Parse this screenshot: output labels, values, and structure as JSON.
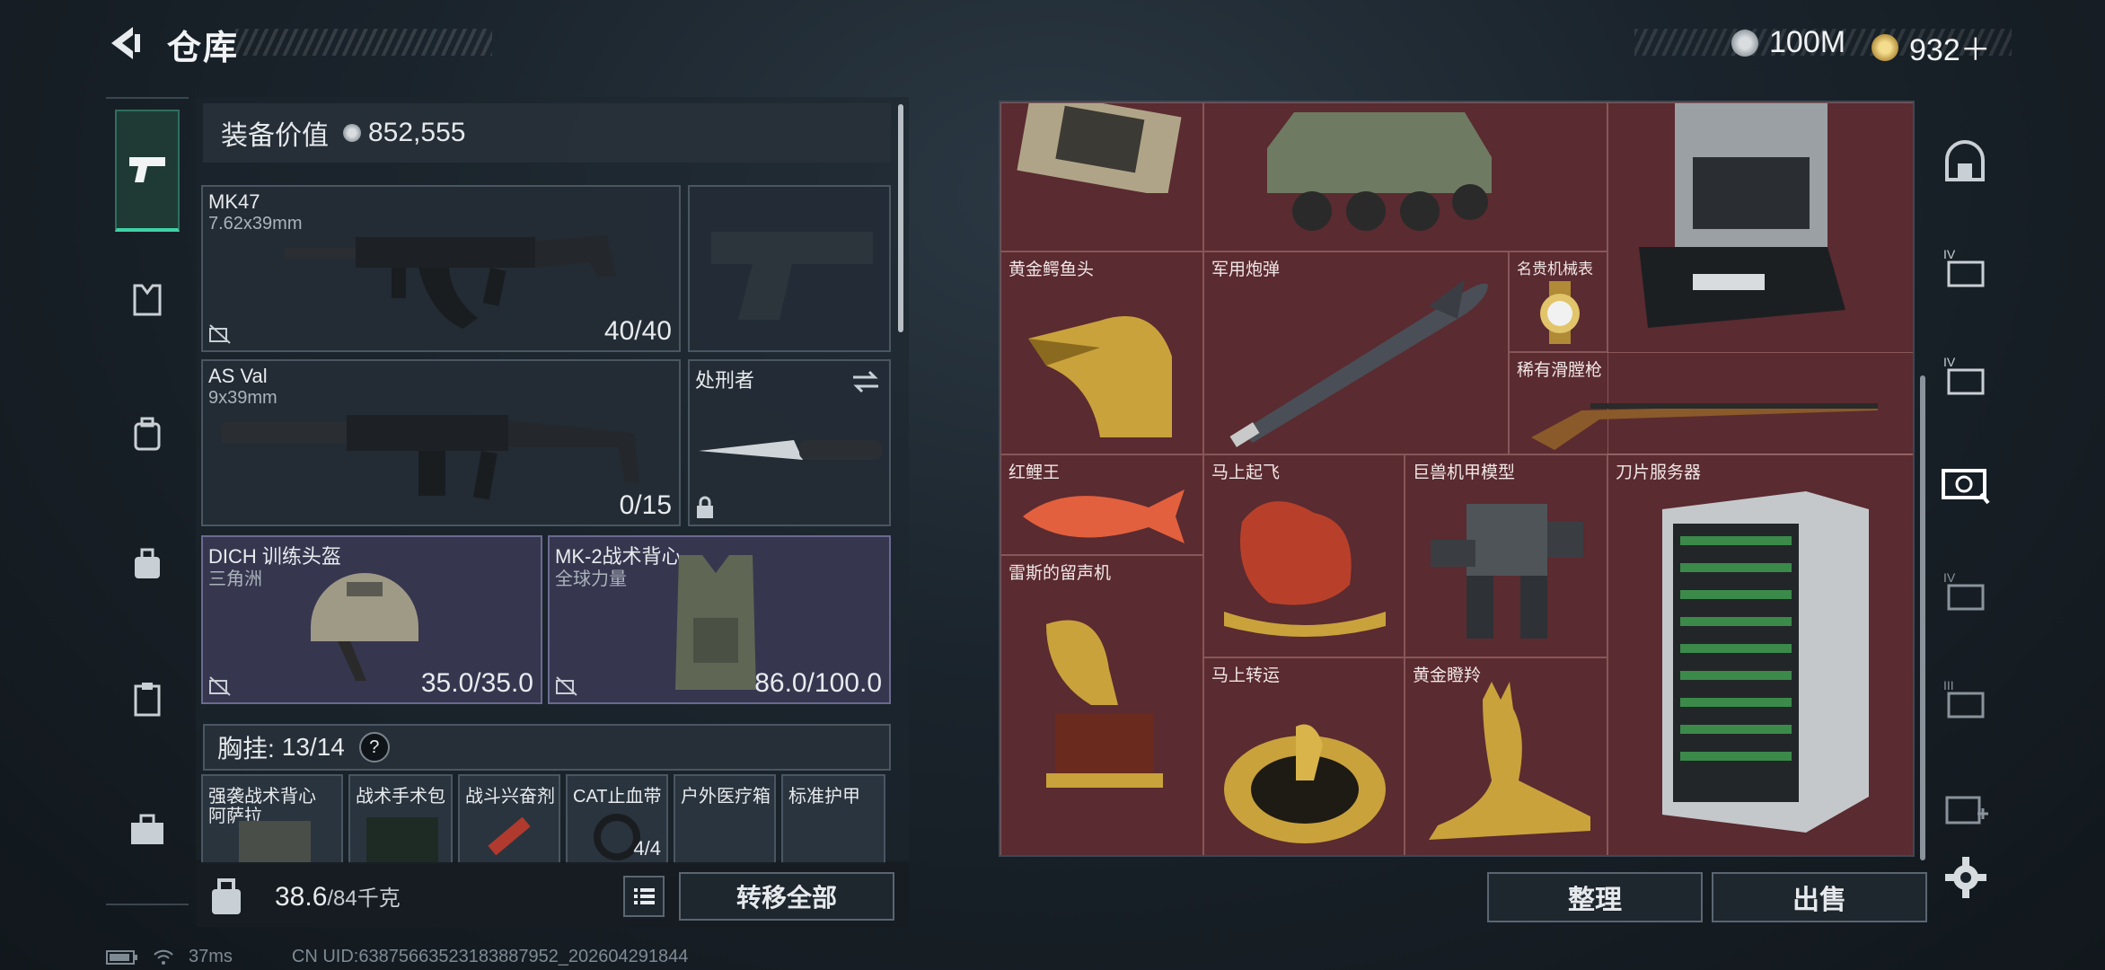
{
  "header": {
    "title": "仓库",
    "currencies": [
      {
        "icon": "silver-coin-icon",
        "amount": "100M"
      },
      {
        "icon": "gold-coin-icon",
        "amount": "932＋"
      }
    ]
  },
  "left_rail": {
    "items": [
      {
        "icon": "pistol-icon",
        "active": true
      },
      {
        "icon": "armor-icon"
      },
      {
        "icon": "backpack-icon"
      },
      {
        "icon": "bag-icon"
      },
      {
        "icon": "clipboard-icon"
      },
      {
        "icon": "toolbox-icon"
      }
    ]
  },
  "loadout": {
    "value_label": "装备价值",
    "value": "852,555",
    "weapons": [
      {
        "name": "MK47",
        "caliber": "7.62x39mm",
        "ammo": "40/40"
      },
      {
        "name": "AS Val",
        "caliber": "9x39mm",
        "ammo": "0/15"
      }
    ],
    "melee": {
      "name": "处刑者"
    },
    "helmet": {
      "name": "DICH 训练头盔",
      "sub": "三角洲",
      "durability": "35.0/35.0"
    },
    "armor": {
      "name": "MK-2战术背心",
      "sub": "全球力量",
      "durability": "86.0/100.0"
    },
    "vest": {
      "label": "胸挂:",
      "count": "13/14",
      "help": "?"
    },
    "vest_items": [
      {
        "name": "强袭战术背心",
        "sub": "阿萨拉"
      },
      {
        "name": "战术手术包"
      },
      {
        "name": "战斗兴奋剂"
      },
      {
        "name": "CAT止血带",
        "count": "4/4"
      },
      {
        "name": "户外医疗箱"
      },
      {
        "name": "标准护甲"
      }
    ],
    "weight": "38.6",
    "weight_max": "/84千克",
    "transfer_all": "转移全部"
  },
  "storage": {
    "items": [
      {
        "name": "黄金鳄鱼头",
        "icon": "gold-crocodile-head"
      },
      {
        "name": "军用炮弹",
        "icon": "missile"
      },
      {
        "name": "名贵机械表",
        "icon": "watch"
      },
      {
        "name": "稀有滑膛枪",
        "icon": "musket"
      },
      {
        "name": "红鲤王",
        "icon": "red-carp"
      },
      {
        "name": "马上起飞",
        "icon": "flying-horse"
      },
      {
        "name": "巨兽机甲模型",
        "icon": "mech-model"
      },
      {
        "name": "刀片服务器",
        "icon": "blade-server"
      },
      {
        "name": "雷斯的留声机",
        "icon": "gramophone"
      },
      {
        "name": "马上转运",
        "icon": "horse-medallion"
      },
      {
        "name": "黄金瞪羚",
        "icon": "gold-gazelle"
      }
    ],
    "sort": "整理",
    "sell": "出售"
  },
  "right_rail": {
    "items": [
      "vault-icon",
      "storage-iv-icon",
      "storage-iv-icon-2",
      "storage-safe-icon",
      "storage-iv-icon-3",
      "storage-iii-icon",
      "add-storage-icon"
    ]
  },
  "status": {
    "ping": "37ms",
    "uid": "CN UID:63875663523183887952_202604291844"
  },
  "colors": {
    "accent": "#3fd2a6",
    "storage_bg": "#5a2b30",
    "panel": "#1e262e"
  }
}
